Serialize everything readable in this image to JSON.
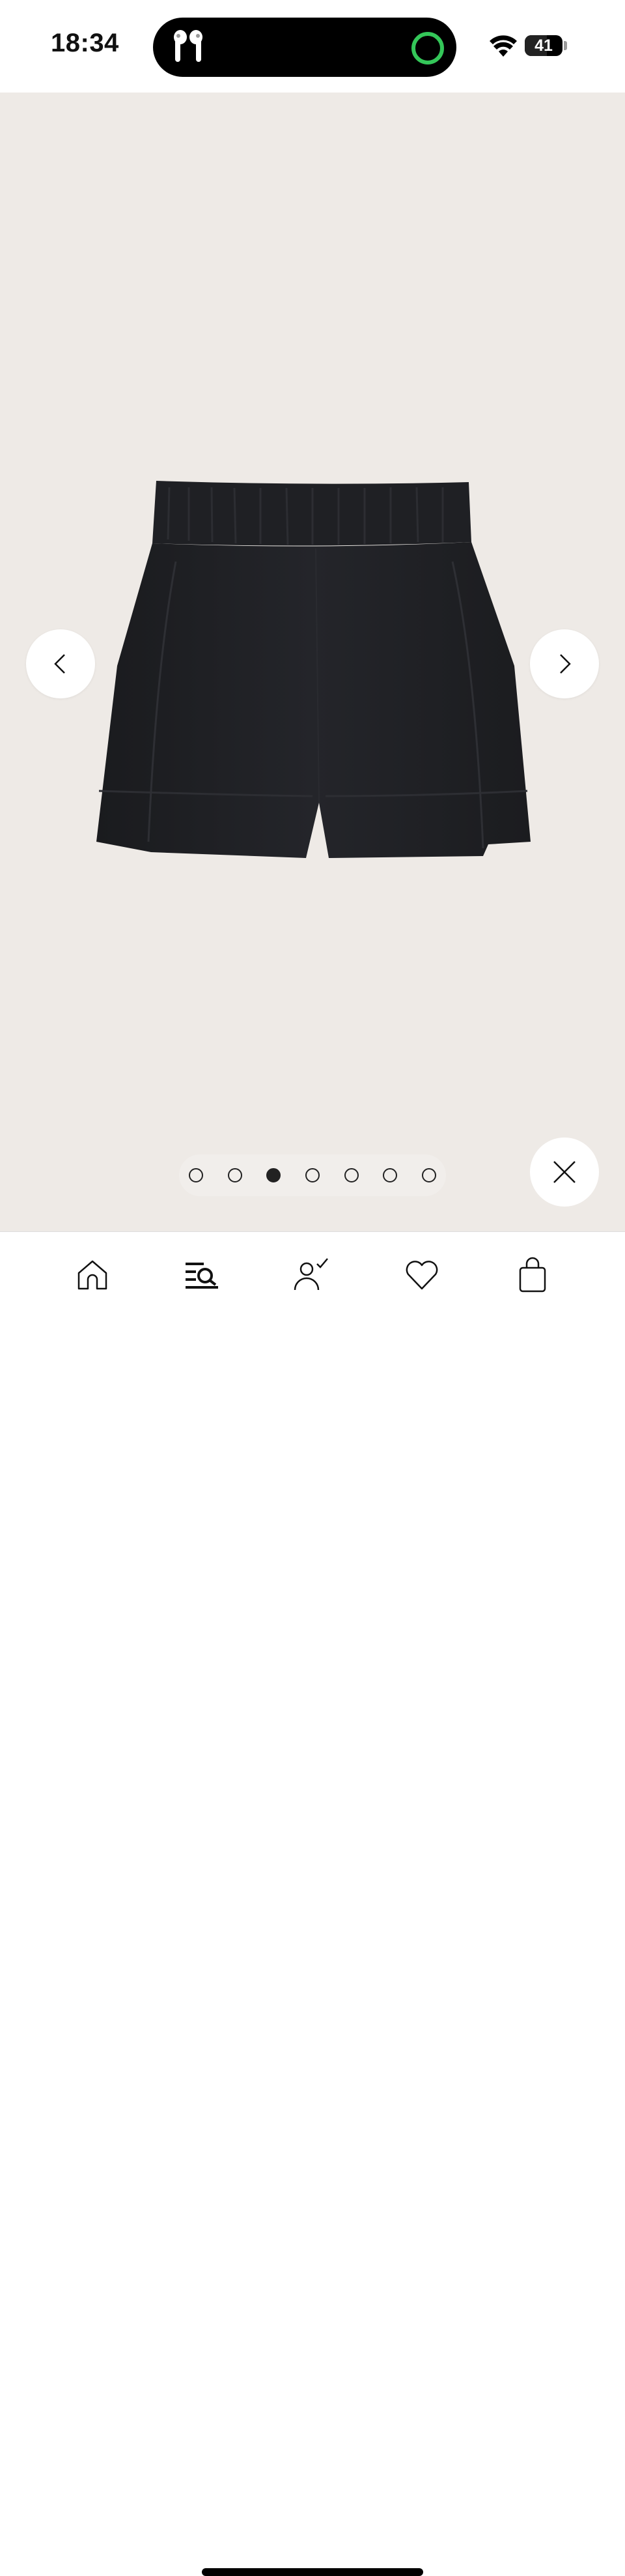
{
  "status_bar": {
    "time": "18:34",
    "battery_level": "41",
    "icons": [
      "airpods-icon",
      "screen-recording-indicator",
      "wifi-icon",
      "battery-icon"
    ],
    "recording_color": "#34c759"
  },
  "viewer": {
    "background": "#eeeae6",
    "product_image": "black-linen-pull-on-shorts",
    "prev_icon": "chevron-left-icon",
    "next_icon": "chevron-right-icon",
    "close_icon": "close-icon",
    "pagination": {
      "total": 7,
      "current": 3
    }
  },
  "tab_bar": {
    "tabs": [
      {
        "name": "home",
        "icon": "home-icon"
      },
      {
        "name": "search",
        "icon": "search-list-icon",
        "active": true
      },
      {
        "name": "account",
        "icon": "account-check-icon"
      },
      {
        "name": "favorites",
        "icon": "heart-icon"
      },
      {
        "name": "bag",
        "icon": "shopping-bag-icon"
      }
    ]
  }
}
